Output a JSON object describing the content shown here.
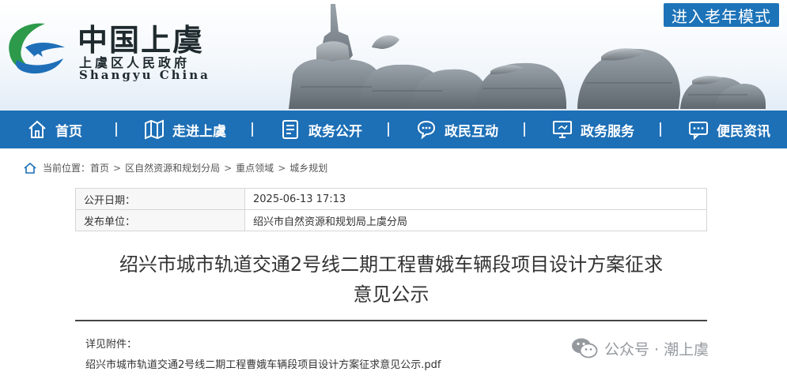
{
  "header": {
    "logo_title": "中国上虞",
    "logo_subtitle": "上虞区人民政府",
    "logo_english": "Shangyu China",
    "elder_mode_label": "进入老年模式"
  },
  "nav": {
    "items": [
      {
        "label": "首页",
        "icon": "home-icon"
      },
      {
        "label": "走进上虞",
        "icon": "map-icon"
      },
      {
        "label": "政务公开",
        "icon": "document-icon"
      },
      {
        "label": "政民互动",
        "icon": "chat-icon"
      },
      {
        "label": "政务服务",
        "icon": "monitor-icon"
      },
      {
        "label": "便民资讯",
        "icon": "info-chat-icon"
      }
    ]
  },
  "breadcrumb": {
    "prefix": "当前位置：",
    "items": [
      "首页",
      "区自然资源和规划分局",
      "重点领域",
      "城乡规划"
    ],
    "separator": ">"
  },
  "info": {
    "rows": [
      {
        "key": "公开日期：",
        "value": "2025-06-13 17:13"
      },
      {
        "key": "发布单位：",
        "value": "绍兴市自然资源和规划局上虞分局"
      }
    ]
  },
  "document": {
    "title_line1": "绍兴市城市轨道交通2号线二期工程曹娥车辆段项目设计方案征求",
    "title_line2": "意见公示",
    "attachments_label": "详见附件：",
    "attachment_file": "绍兴市城市轨道交通2号线二期工程曹娥车辆段项目设计方案征求意见公示.pdf"
  },
  "watermark": {
    "text": "公众号 · 潮上虞",
    "icon": "wechat-icon"
  },
  "colors": {
    "nav_bg": "#1d6fb6",
    "elder_btn_bg": "#1d73b8",
    "logo_green": "#2c9a4a",
    "logo_blue": "#1e6fb8"
  }
}
